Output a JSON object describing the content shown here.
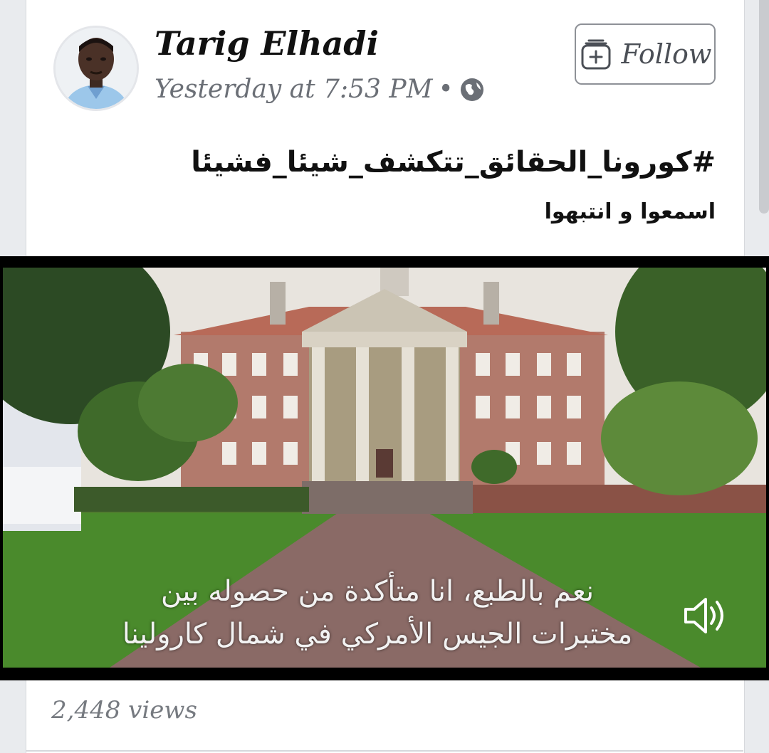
{
  "post": {
    "author": "Tarig Elhadi",
    "timestamp": "Yesterday at 7:53 PM",
    "separator": "•",
    "privacy_icon": "globe-icon",
    "follow_label": "Follow",
    "hashtag": "#كورونا_الحقائق_تتكشف_شيئا_فشيئا",
    "text": "اسمعوا و انتبهوا"
  },
  "video": {
    "subtitle_line1": "نعم بالطبع، انا متأكدة من حصوله بين",
    "subtitle_line2": "مختبرات الجيس الأمركي في شمال كارولينا",
    "volume_icon": "speaker-icon"
  },
  "footer": {
    "views": "2,448 views"
  }
}
